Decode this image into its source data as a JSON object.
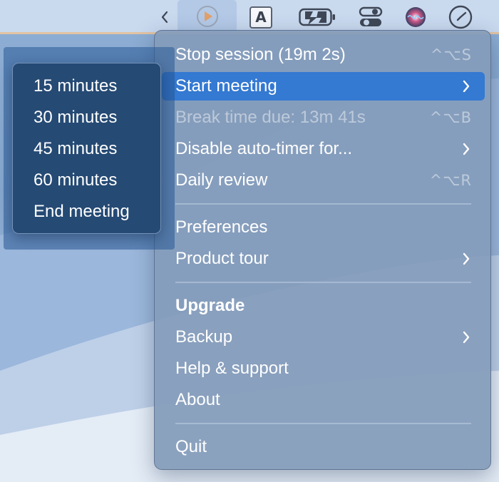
{
  "menubar": {
    "icons": [
      "chevron-left-icon",
      "app-play-icon",
      "keyboard-input-icon",
      "battery-charging-icon",
      "control-center-icon",
      "siri-icon",
      "clock-icon"
    ],
    "keyboard_letter": "A",
    "accent": "#e2a06a"
  },
  "menu": {
    "items": [
      {
        "label": "Stop session (19m 2s)",
        "shortcut": "^⌥S"
      },
      {
        "label": "Start meeting",
        "submenu": true,
        "selected": true
      },
      {
        "label": "Break time due: 13m 41s",
        "shortcut": "^⌥B",
        "disabled": true
      },
      {
        "label": "Disable auto-timer for...",
        "submenu": true
      },
      {
        "label": "Daily review",
        "shortcut": "^⌥R"
      },
      {
        "label": "Preferences"
      },
      {
        "label": "Product tour",
        "submenu": true
      },
      {
        "label": "Upgrade",
        "bold": true
      },
      {
        "label": "Backup",
        "submenu": true
      },
      {
        "label": "Help & support"
      },
      {
        "label": "About"
      },
      {
        "label": "Quit"
      }
    ],
    "selection_color": "#3479d2"
  },
  "submenu": {
    "items": [
      "15 minutes",
      "30 minutes",
      "45 minutes",
      "60 minutes",
      "End meeting"
    ]
  }
}
